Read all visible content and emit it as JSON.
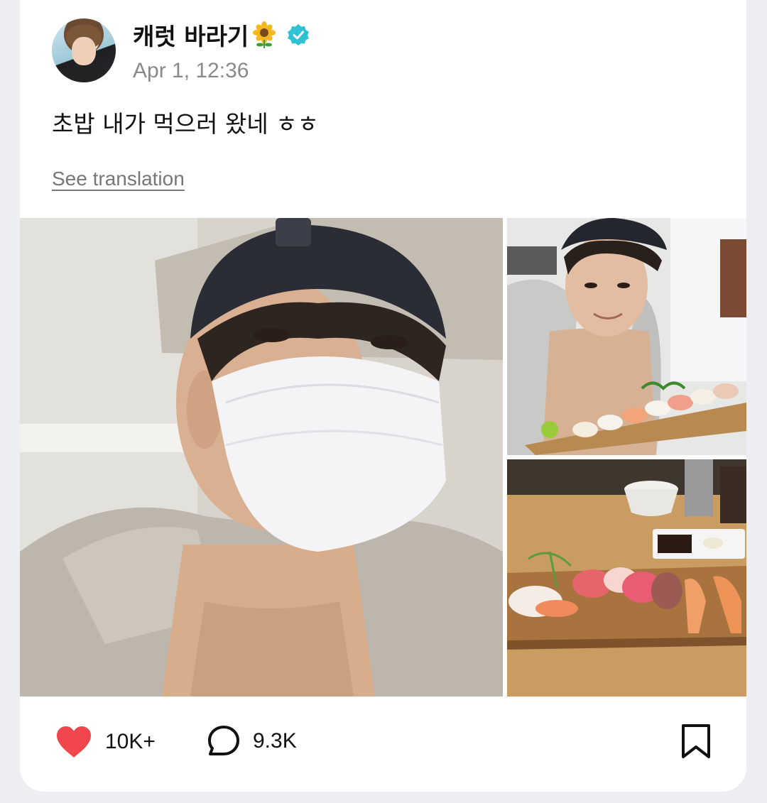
{
  "post": {
    "author_name": "캐럿 바라기",
    "author_emoji": "sunflower",
    "verified_icon": "verified-badge-icon",
    "timestamp": "Apr 1, 12:36",
    "text": "초밥 내가 먹으러 왔네 ㅎㅎ",
    "translate_label": "See translation"
  },
  "photos": [
    {
      "name": "photo-selfie-masked"
    },
    {
      "name": "photo-selfie-sushi"
    },
    {
      "name": "photo-sushi-platter"
    }
  ],
  "actions": {
    "likes": "10K+",
    "comments": "9.3K"
  },
  "colors": {
    "like": "#f0474f",
    "verified": "#2fc2d4",
    "timestamp": "#8a8a8a"
  }
}
